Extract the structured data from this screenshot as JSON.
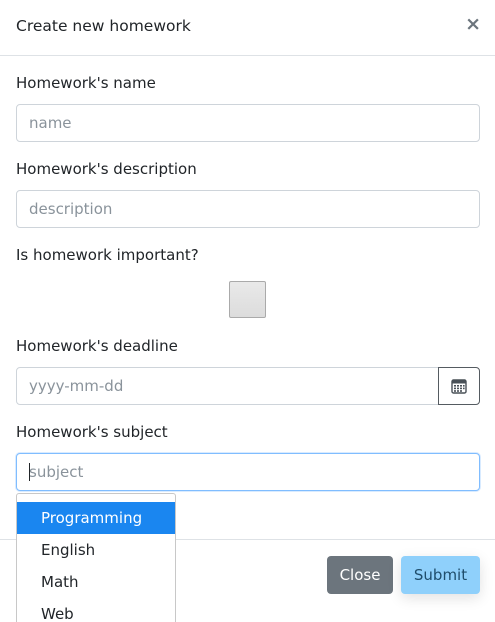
{
  "modal": {
    "title": "Create new homework",
    "close_icon": "×"
  },
  "form": {
    "name": {
      "label": "Homework's name",
      "placeholder": "name",
      "value": ""
    },
    "description": {
      "label": "Homework's description",
      "placeholder": "description",
      "value": ""
    },
    "important": {
      "label": "Is homework important?",
      "checked": false
    },
    "deadline": {
      "label": "Homework's deadline",
      "placeholder": "yyyy-mm-dd",
      "value": "",
      "icon": "calendar-icon"
    },
    "subject": {
      "label": "Homework's subject",
      "placeholder": "subject",
      "value": "",
      "options": [
        "Programming",
        "English",
        "Math",
        "Web"
      ],
      "highlighted_index": 0
    }
  },
  "footer": {
    "close_label": "Close",
    "submit_label": "Submit"
  },
  "colors": {
    "highlight": "#1a86f0",
    "close_button": "#6c757d",
    "submit_button": "#8fd0fb",
    "focus_border": "#80bdff"
  }
}
